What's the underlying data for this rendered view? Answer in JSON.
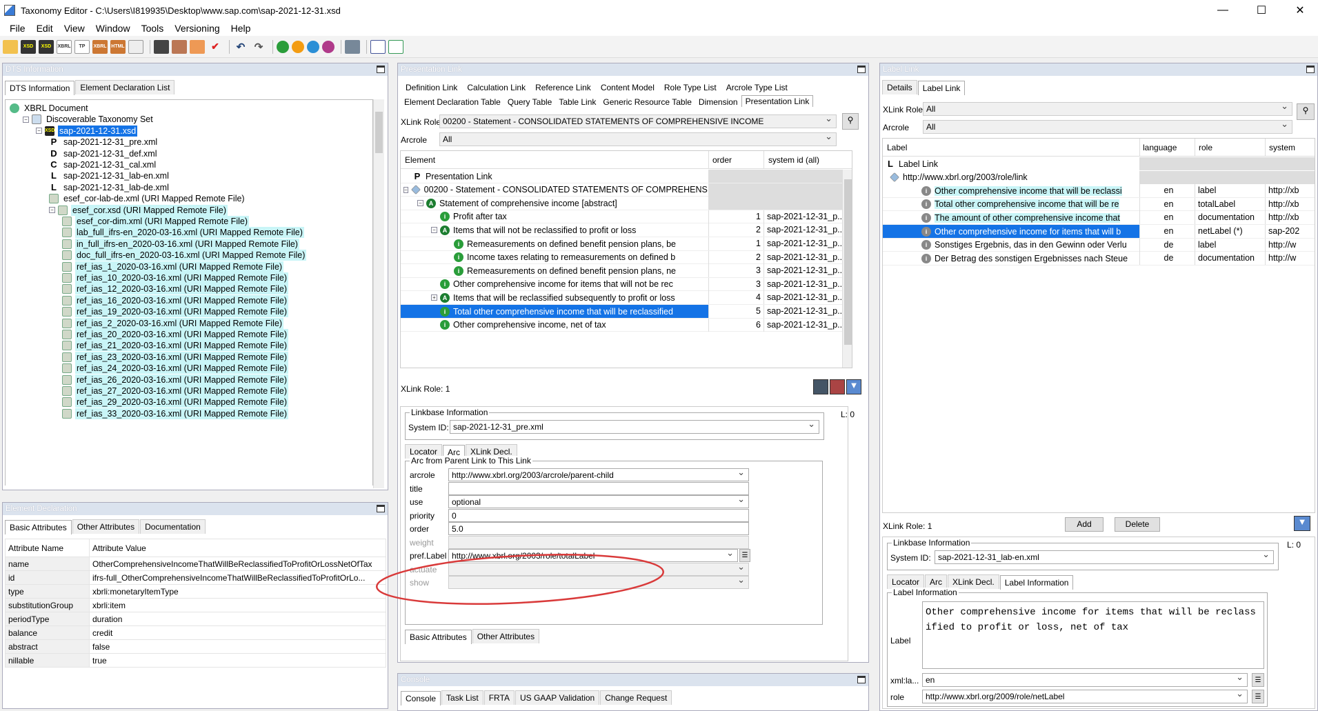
{
  "window": {
    "title": "Taxonomy Editor - C:\\Users\\I819935\\Desktop\\www.sap.com\\sap-2021-12-31.xsd",
    "minimize": "—",
    "maximize": "☐",
    "close": "✕"
  },
  "menu": [
    "File",
    "Edit",
    "View",
    "Window",
    "Tools",
    "Versioning",
    "Help"
  ],
  "toolbar": {
    "icons": [
      "open-icon",
      "xsd-icon",
      "xsd-remote-icon",
      "xbrl-icon",
      "tp-icon",
      "xbrl-file-icon",
      "html-icon",
      "list-icon",
      "save-icon",
      "save-all-icon",
      "export-icon",
      "validate-icon",
      "undo-icon",
      "redo-icon",
      "green-icon",
      "orange-icon",
      "blue-icon",
      "pink-icon",
      "tool-icon",
      "import-icon",
      "export2-icon"
    ]
  },
  "dts": {
    "header": "DTS Information",
    "tabs": [
      "DTS Information",
      "Element Declaration List"
    ],
    "tree": [
      {
        "label": "XBRL Document",
        "indent": 0,
        "icon": "globe"
      },
      {
        "label": "Discoverable Taxonomy Set",
        "indent": 1,
        "icon": "set",
        "exp": "−"
      },
      {
        "label": "sap-2021-12-31.xsd",
        "indent": 2,
        "icon": "xsd",
        "exp": "−",
        "sel": true
      },
      {
        "label": "sap-2021-12-31_pre.xml",
        "indent": 3,
        "icon": "P"
      },
      {
        "label": "sap-2021-12-31_def.xml",
        "indent": 3,
        "icon": "D"
      },
      {
        "label": "sap-2021-12-31_cal.xml",
        "indent": 3,
        "icon": "C"
      },
      {
        "label": "sap-2021-12-31_lab-en.xml",
        "indent": 3,
        "icon": "L"
      },
      {
        "label": "sap-2021-12-31_lab-de.xml",
        "indent": 3,
        "icon": "L"
      },
      {
        "label": "esef_cor-lab-de.xml (URI Mapped Remote File)",
        "indent": 3,
        "icon": "remote"
      },
      {
        "label": "esef_cor.xsd (URI Mapped Remote File)",
        "indent": 3,
        "icon": "remote",
        "exp": "−",
        "hl": true
      },
      {
        "label": "esef_cor-dim.xml (URI Mapped Remote File)",
        "indent": 4,
        "icon": "remote",
        "hl": true
      },
      {
        "label": "lab_full_ifrs-en_2020-03-16.xml (URI Mapped Remote File)",
        "indent": 4,
        "icon": "remote",
        "hl": true
      },
      {
        "label": "in_full_ifrs-en_2020-03-16.xml (URI Mapped Remote File)",
        "indent": 4,
        "icon": "remote",
        "hl": true
      },
      {
        "label": "doc_full_ifrs-en_2020-03-16.xml (URI Mapped Remote File)",
        "indent": 4,
        "icon": "remote",
        "hl": true
      },
      {
        "label": "ref_ias_1_2020-03-16.xml (URI Mapped Remote File)",
        "indent": 4,
        "icon": "remote",
        "hl": true
      },
      {
        "label": "ref_ias_10_2020-03-16.xml (URI Mapped Remote File)",
        "indent": 4,
        "icon": "remote",
        "hl": true
      },
      {
        "label": "ref_ias_12_2020-03-16.xml (URI Mapped Remote File)",
        "indent": 4,
        "icon": "remote",
        "hl": true
      },
      {
        "label": "ref_ias_16_2020-03-16.xml (URI Mapped Remote File)",
        "indent": 4,
        "icon": "remote",
        "hl": true
      },
      {
        "label": "ref_ias_19_2020-03-16.xml (URI Mapped Remote File)",
        "indent": 4,
        "icon": "remote",
        "hl": true
      },
      {
        "label": "ref_ias_2_2020-03-16.xml (URI Mapped Remote File)",
        "indent": 4,
        "icon": "remote",
        "hl": true
      },
      {
        "label": "ref_ias_20_2020-03-16.xml (URI Mapped Remote File)",
        "indent": 4,
        "icon": "remote",
        "hl": true
      },
      {
        "label": "ref_ias_21_2020-03-16.xml (URI Mapped Remote File)",
        "indent": 4,
        "icon": "remote",
        "hl": true
      },
      {
        "label": "ref_ias_23_2020-03-16.xml (URI Mapped Remote File)",
        "indent": 4,
        "icon": "remote",
        "hl": true
      },
      {
        "label": "ref_ias_24_2020-03-16.xml (URI Mapped Remote File)",
        "indent": 4,
        "icon": "remote",
        "hl": true
      },
      {
        "label": "ref_ias_26_2020-03-16.xml (URI Mapped Remote File)",
        "indent": 4,
        "icon": "remote",
        "hl": true
      },
      {
        "label": "ref_ias_27_2020-03-16.xml (URI Mapped Remote File)",
        "indent": 4,
        "icon": "remote",
        "hl": true
      },
      {
        "label": "ref_ias_29_2020-03-16.xml (URI Mapped Remote File)",
        "indent": 4,
        "icon": "remote",
        "hl": true
      },
      {
        "label": "ref_ias_33_2020-03-16.xml (URI Mapped Remote File)",
        "indent": 4,
        "icon": "remote",
        "hl": true
      }
    ]
  },
  "element_decl": {
    "header": "Element Declaration",
    "tabs": [
      "Basic Attributes",
      "Other Attributes",
      "Documentation"
    ],
    "col_name": "Attribute Name",
    "col_value": "Attribute Value",
    "rows": [
      [
        "name",
        "OtherComprehensiveIncomeThatWillBeReclassifiedToProfitOrLossNetOfTax"
      ],
      [
        "id",
        "ifrs-full_OtherComprehensiveIncomeThatWillBeReclassifiedToProfitOrLo..."
      ],
      [
        "type",
        "xbrli:monetaryItemType"
      ],
      [
        "substitutionGroup",
        "xbrli:item"
      ],
      [
        "periodType",
        "duration"
      ],
      [
        "balance",
        "credit"
      ],
      [
        "abstract",
        "false"
      ],
      [
        "nillable",
        "true"
      ]
    ]
  },
  "presentation": {
    "header": "Presentation Link",
    "tabs_row1": [
      "Definition Link",
      "Calculation Link",
      "Reference Link",
      "Content Model",
      "Role Type List",
      "Arcrole Type List"
    ],
    "tabs_row2": [
      "Element Declaration Table",
      "Query Table",
      "Table Link",
      "Generic Resource Table",
      "Dimension",
      "Presentation Link"
    ],
    "xlink_role_label": "XLink Role",
    "xlink_role_value": "00200 - Statement - CONSOLIDATED STATEMENTS OF COMPREHENSIVE INCOME",
    "arcrole_label": "Arcrole",
    "arcrole_value": "All",
    "col_element": "Element",
    "col_order": "order",
    "col_sysid": "system id (all)",
    "rows": [
      {
        "label": "Presentation Link",
        "indent": 0,
        "icon": "P",
        "order": "",
        "sys": ""
      },
      {
        "label": "00200 - Statement - CONSOLIDATED STATEMENTS OF COMPREHENSI",
        "indent": 0,
        "icon": "role",
        "exp": "−",
        "order": "",
        "sys": ""
      },
      {
        "label": "Statement of comprehensive income [abstract]",
        "indent": 1,
        "icon": "abs",
        "exp": "−",
        "order": "",
        "sys": ""
      },
      {
        "label": "Profit after tax",
        "indent": 2,
        "icon": "i",
        "order": "1",
        "sys": "sap-2021-12-31_p..."
      },
      {
        "label": "Items that will not be reclassified to profit or loss",
        "indent": 2,
        "icon": "abs",
        "exp": "−",
        "order": "2",
        "sys": "sap-2021-12-31_p..."
      },
      {
        "label": "Remeasurements on defined benefit pension plans, be",
        "indent": 3,
        "icon": "i",
        "order": "1",
        "sys": "sap-2021-12-31_p..."
      },
      {
        "label": "Income taxes relating to remeasurements on defined b",
        "indent": 3,
        "icon": "i",
        "order": "2",
        "sys": "sap-2021-12-31_p..."
      },
      {
        "label": "Remeasurements on defined benefit pension plans, ne",
        "indent": 3,
        "icon": "i",
        "order": "3",
        "sys": "sap-2021-12-31_p..."
      },
      {
        "label": "Other comprehensive income for items that will not be rec",
        "indent": 2,
        "icon": "i",
        "order": "3",
        "sys": "sap-2021-12-31_p..."
      },
      {
        "label": "Items that will be reclassified subsequently to profit or loss",
        "indent": 2,
        "icon": "abs",
        "exp": "+",
        "order": "4",
        "sys": "sap-2021-12-31_p..."
      },
      {
        "label": "Total other comprehensive income that will be reclassified",
        "indent": 2,
        "icon": "i",
        "order": "5",
        "sys": "sap-2021-12-31_p...",
        "sel": true
      },
      {
        "label": "Other comprehensive income, net of tax",
        "indent": 2,
        "icon": "i",
        "order": "6",
        "sys": "sap-2021-12-31_p..."
      }
    ],
    "xlink_role_count": "XLink Role: 1",
    "l_count": "L: 0",
    "linkbase": {
      "title": "Linkbase Information",
      "sysid_label": "System ID:",
      "sysid_value": "sap-2021-12-31_pre.xml",
      "tabs": [
        "Locator",
        "Arc",
        "XLink Decl."
      ],
      "arc_title": "Arc from Parent Link to This Link",
      "rows": [
        [
          "arcrole",
          "http://www.xbrl.org/2003/arcrole/parent-child",
          "dd"
        ],
        [
          "title",
          "",
          ""
        ],
        [
          "use",
          "optional",
          "dd"
        ],
        [
          "priority",
          "0",
          ""
        ],
        [
          "order",
          "5.0",
          ""
        ],
        [
          "weight",
          "",
          "grey"
        ],
        [
          "pref.Label",
          "http://www.xbrl.org/2003/role/totalLabel",
          "dd"
        ],
        [
          "actuate",
          "",
          "ddgrey"
        ],
        [
          "show",
          "",
          "ddgrey"
        ]
      ],
      "bottom_tabs": [
        "Basic Attributes",
        "Other Attributes"
      ]
    }
  },
  "console": {
    "header": "Console",
    "tabs": [
      "Console",
      "Task List",
      "FRTA",
      "US GAAP Validation",
      "Change Request"
    ]
  },
  "label_link": {
    "header": "Label Link",
    "tabs": [
      "Details",
      "Label Link"
    ],
    "xlink_role_label": "XLink Role",
    "xlink_role_value": "All",
    "arcrole_label": "Arcrole",
    "arcrole_value": "All",
    "col_label": "Label",
    "col_lang": "language",
    "col_role": "role",
    "col_sys": "system",
    "tree_root": "Label Link",
    "tree_link": "http://www.xbrl.org/2003/role/link",
    "rows": [
      {
        "label": "Other comprehensive income that will be reclassi",
        "lang": "en",
        "role": "label",
        "sys": "http://xb",
        "hl": true
      },
      {
        "label": "Total other comprehensive income that will be re",
        "lang": "en",
        "role": "totalLabel",
        "sys": "http://xb",
        "hl": true
      },
      {
        "label": "The amount of other comprehensive income that",
        "lang": "en",
        "role": "documentation",
        "sys": "http://xb",
        "hl": true
      },
      {
        "label": "Other comprehensive income for items that will b",
        "lang": "en",
        "role": "netLabel (*)",
        "sys": "sap-202",
        "sel": true
      },
      {
        "label": "Sonstiges Ergebnis, das in den Gewinn oder Verlu",
        "lang": "de",
        "role": "label",
        "sys": "http://w"
      },
      {
        "label": "Der Betrag des sonstigen Ergebnisses nach Steue",
        "lang": "de",
        "role": "documentation",
        "sys": "http://w"
      }
    ],
    "xlink_role_count": "XLink Role: 1",
    "add": "Add",
    "delete": "Delete",
    "l_count": "L: 0",
    "linkbase": {
      "title": "Linkbase Information",
      "sysid_label": "System ID:",
      "sysid_value": "sap-2021-12-31_lab-en.xml",
      "tabs": [
        "Locator",
        "Arc",
        "XLink Decl.",
        "Label Information"
      ],
      "info_title": "Label Information",
      "label_label": "Label",
      "label_text": "Other comprehensive income for items that will be reclassified to profit or loss, net of tax",
      "lang_label": "xml:la...",
      "lang_value": "en",
      "role_label": "role",
      "role_value": "http://www.xbrl.org/2009/role/netLabel"
    }
  },
  "colors": {
    "selection": "#1473e6",
    "highlight": "#c9f5f7",
    "annotation": "#d93a3a"
  }
}
